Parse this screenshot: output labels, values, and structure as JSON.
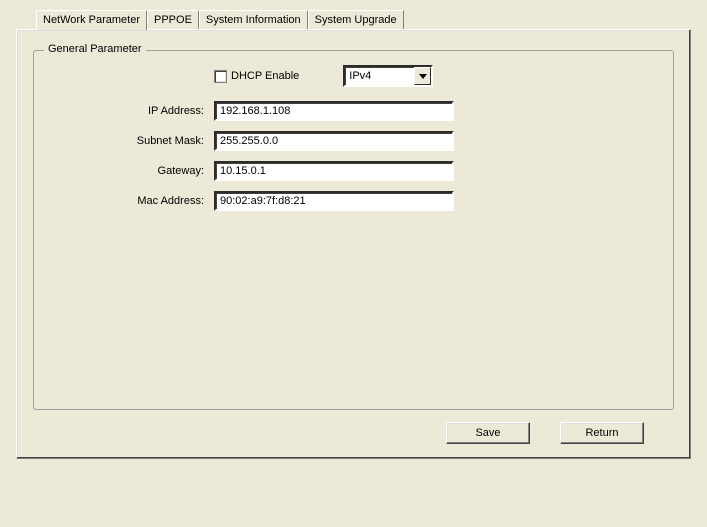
{
  "tabs": {
    "network_parameter": "NetWork Parameter",
    "pppoe": "PPPOE",
    "system_information": "System Information",
    "system_upgrade": "System Upgrade"
  },
  "fieldset": {
    "title": "General Parameter"
  },
  "dhcp": {
    "label": "DHCP Enable",
    "checked": false
  },
  "ip_version": {
    "selected": "IPv4"
  },
  "fields": {
    "ip_address": {
      "label": "IP Address:",
      "value": "192.168.1.108"
    },
    "subnet_mask": {
      "label": "Subnet Mask:",
      "value": "255.255.0.0"
    },
    "gateway": {
      "label": "Gateway:",
      "value": "10.15.0.1"
    },
    "mac_address": {
      "label": "Mac Address:",
      "value": "90:02:a9:7f:d8:21"
    }
  },
  "buttons": {
    "save": "Save",
    "return": "Return"
  }
}
